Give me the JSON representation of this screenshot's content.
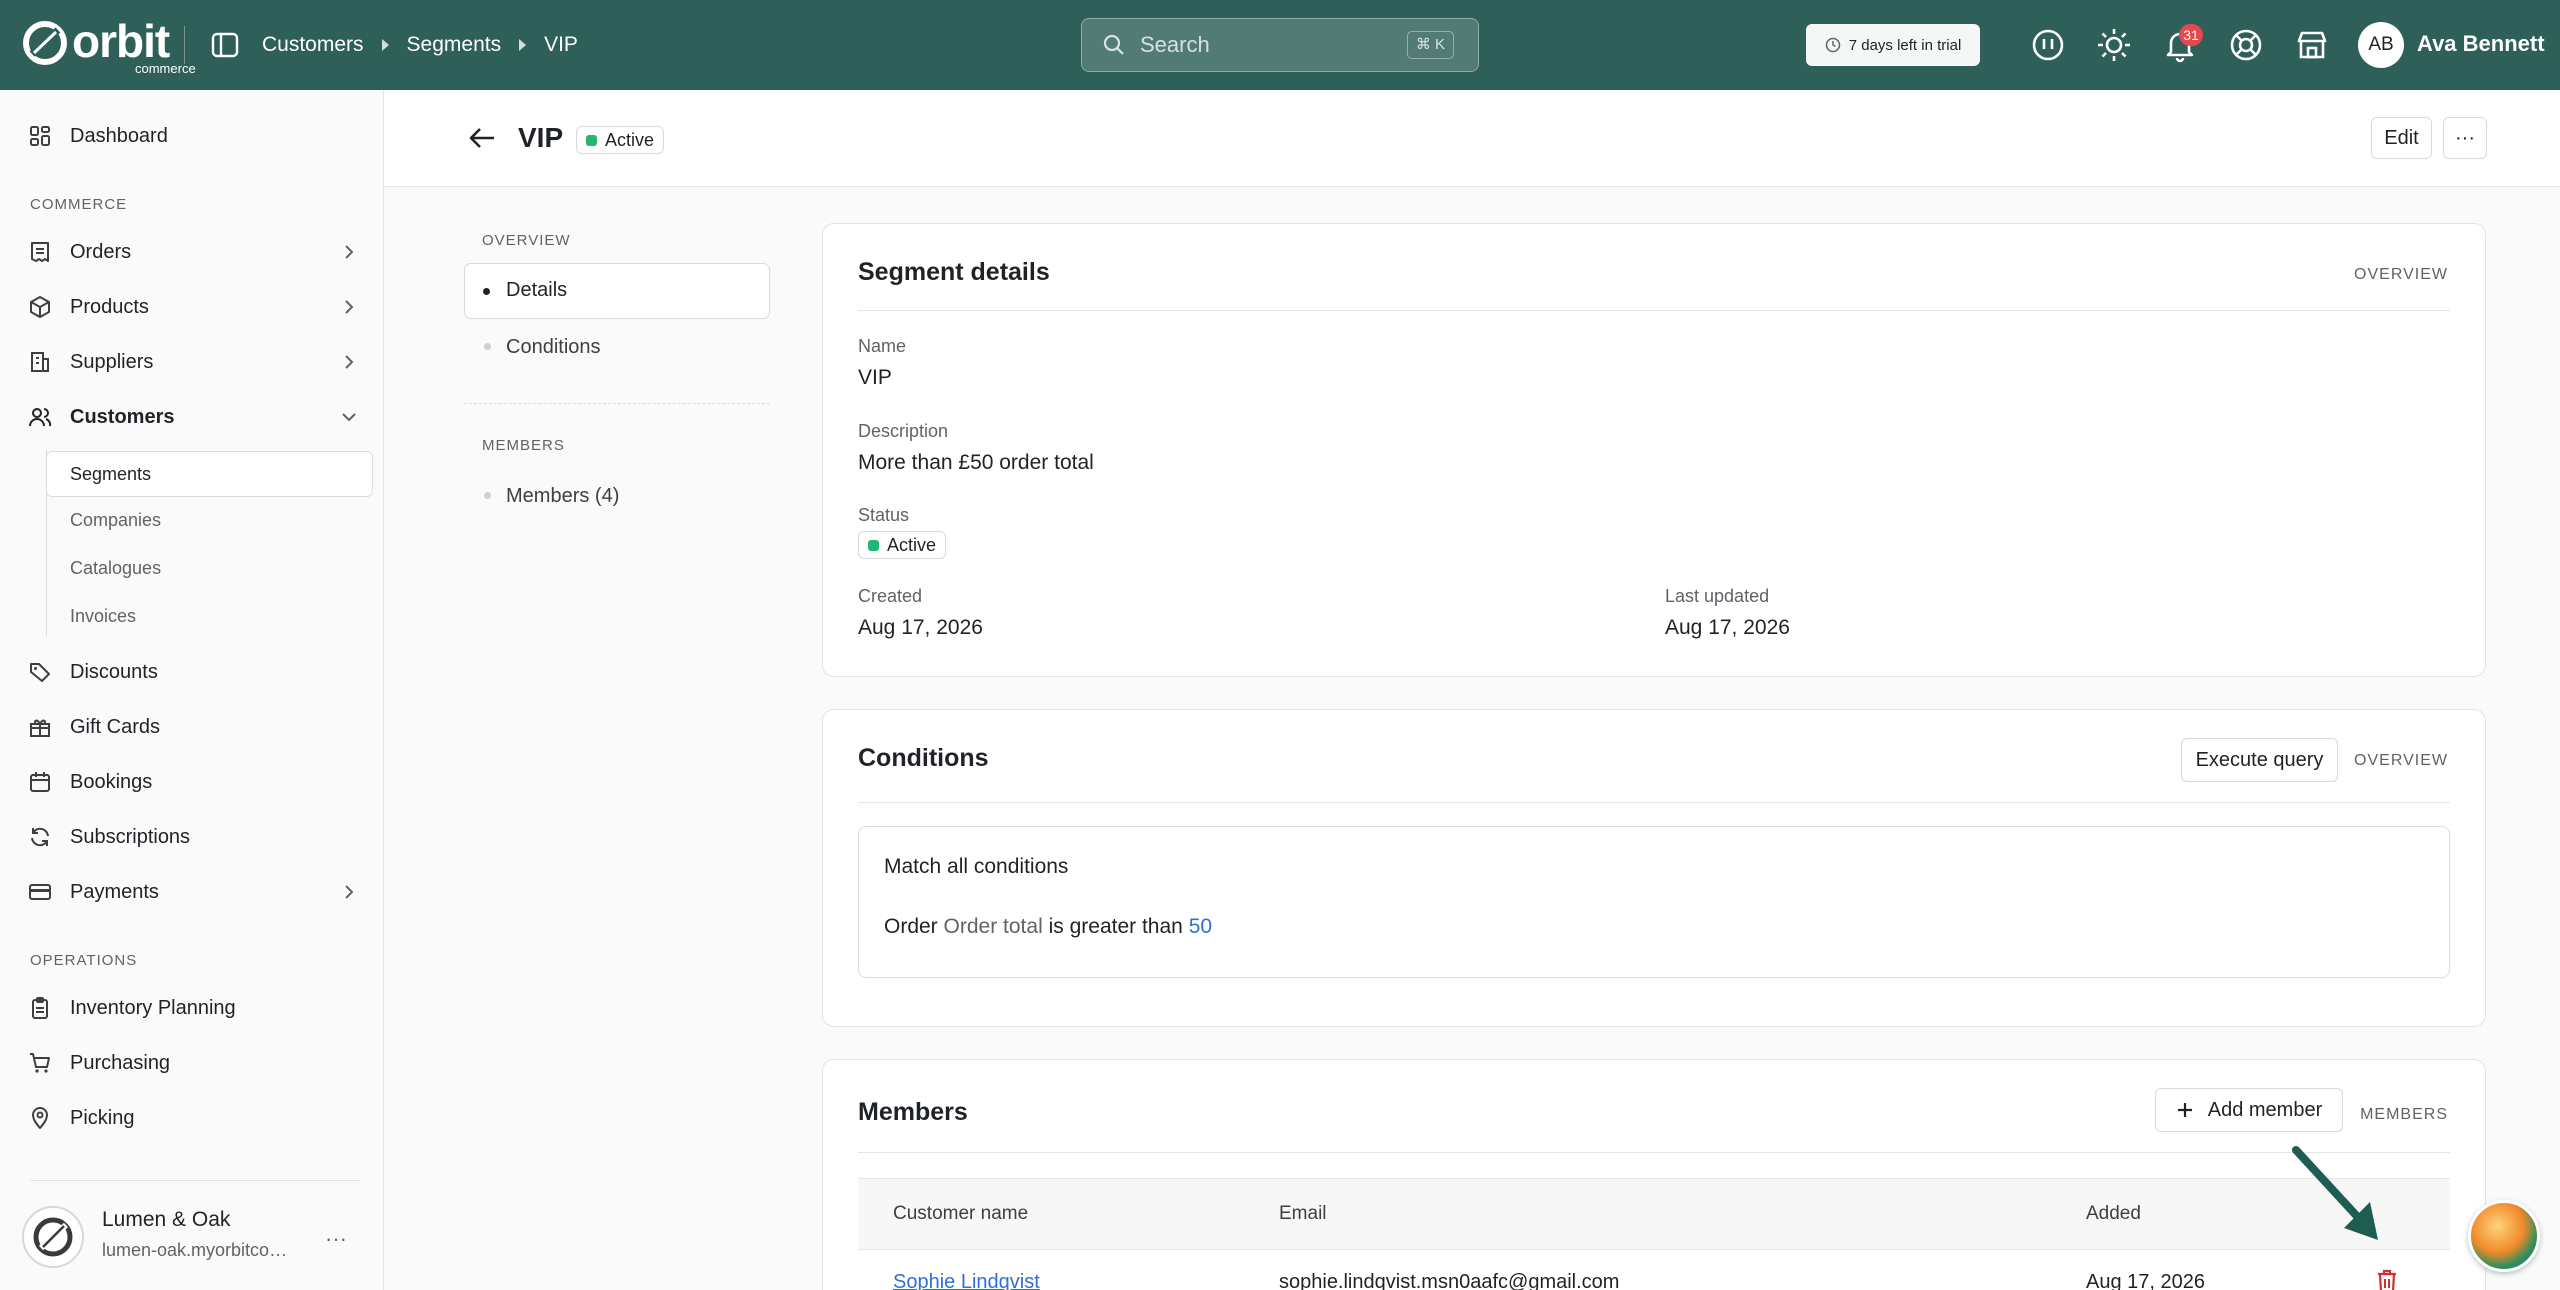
{
  "brand": {
    "name": "orbit",
    "sub": "commerce"
  },
  "breadcrumb": [
    "Customers",
    "Segments",
    "VIP"
  ],
  "search": {
    "placeholder": "Search",
    "shortcut": "⌘ K"
  },
  "trial": {
    "label": "7 days left in trial"
  },
  "notifications": {
    "count": "31"
  },
  "user": {
    "initials": "AB",
    "name": "Ava Bennett"
  },
  "sidebar": {
    "dashboard": "Dashboard",
    "commerce_label": "COMMERCE",
    "orders": "Orders",
    "products": "Products",
    "suppliers": "Suppliers",
    "customers": "Customers",
    "customers_sub": [
      "Segments",
      "Companies",
      "Catalogues",
      "Invoices"
    ],
    "discounts": "Discounts",
    "gift_cards": "Gift Cards",
    "bookings": "Bookings",
    "subscriptions": "Subscriptions",
    "payments": "Payments",
    "operations_label": "OPERATIONS",
    "inventory_planning": "Inventory Planning",
    "purchasing": "Purchasing",
    "picking": "Picking"
  },
  "store": {
    "name": "Lumen & Oak",
    "url": "lumen-oak.myorbitcommerce.com",
    "more": "···"
  },
  "page": {
    "title": "VIP",
    "status": "Active",
    "edit_label": "Edit",
    "more_label": "···"
  },
  "section_nav": {
    "overview_label": "OVERVIEW",
    "details": "Details",
    "conditions": "Conditions",
    "members_label": "MEMBERS",
    "members": "Members (4)"
  },
  "details_card": {
    "title": "Segment details",
    "tag": "OVERVIEW",
    "name_label": "Name",
    "name_value": "VIP",
    "description_label": "Description",
    "description_value": "More than £50 order total",
    "status_label": "Status",
    "status_value": "Active",
    "created_label": "Created",
    "created_value": "Aug 17, 2026",
    "updated_label": "Last updated",
    "updated_value": "Aug 17, 2026"
  },
  "conditions_card": {
    "title": "Conditions",
    "execute_label": "Execute query",
    "tag": "OVERVIEW",
    "match_text": "Match all conditions",
    "rule": {
      "entity": "Order",
      "field": "Order total",
      "operator": "is greater than",
      "value": "50"
    }
  },
  "members_card": {
    "title": "Members",
    "add_label": "Add member",
    "tag": "MEMBERS",
    "columns": [
      "Customer name",
      "Email",
      "Added"
    ],
    "rows": [
      {
        "name": "Sophie Lindqvist",
        "email": "sophie.lindqvist.msn0aafc@gmail.com",
        "added": "Aug 17, 2026"
      }
    ]
  },
  "colors": {
    "topbar": "#2e5f58",
    "accent_link": "#2f6fd6",
    "active_dot": "#22b573",
    "delete_icon": "#d32f2f"
  }
}
